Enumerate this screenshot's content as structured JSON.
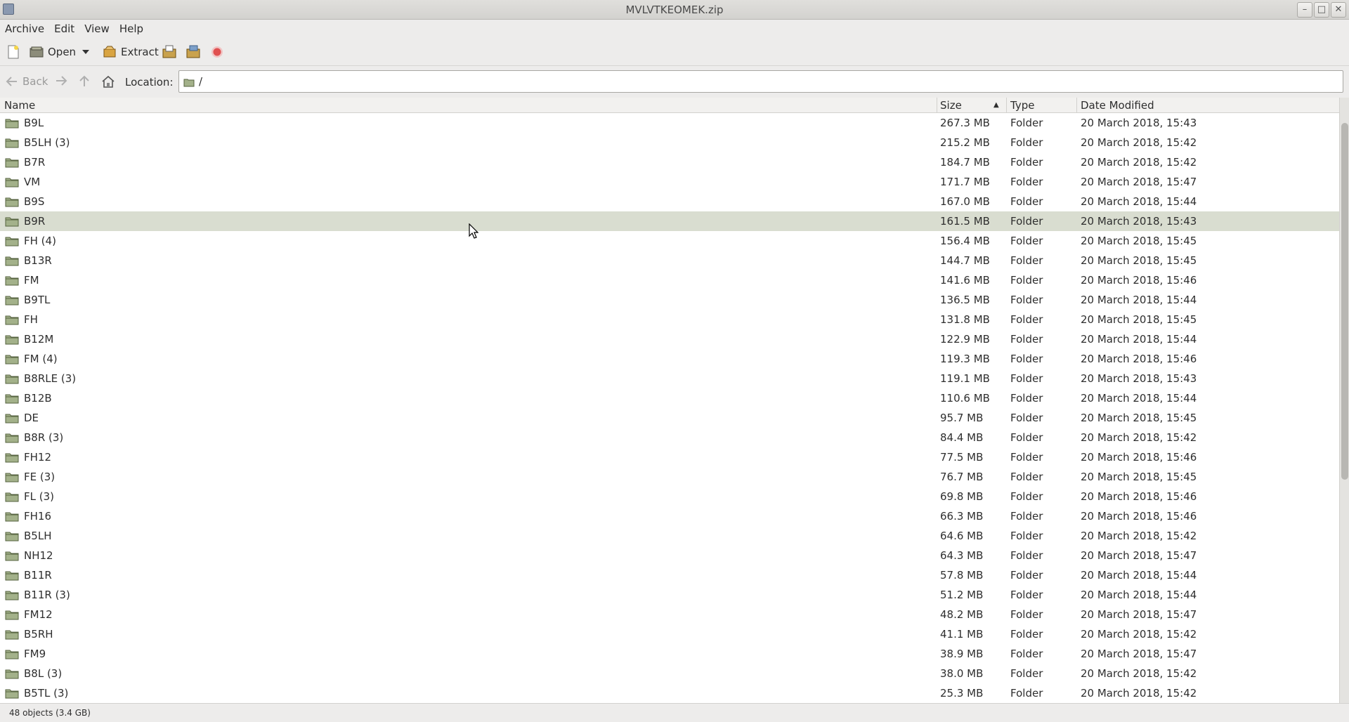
{
  "window": {
    "title": "MVLVTKEOMEK.zip",
    "min_glyph": "–",
    "max_glyph": "□",
    "close_glyph": "✕"
  },
  "menu": [
    "Archive",
    "Edit",
    "View",
    "Help"
  ],
  "toolbar": {
    "open_label": "Open",
    "extract_label": "Extract"
  },
  "location": {
    "back_label": "Back",
    "label": "Location:",
    "path": "/"
  },
  "columns": {
    "name": "Name",
    "size": "Size",
    "type": "Type",
    "date": "Date Modified",
    "sort_glyph": "▲"
  },
  "rows": [
    {
      "name": "B9L",
      "size": "267.3 MB",
      "type": "Folder",
      "date": "20 March 2018, 15:43"
    },
    {
      "name": "B5LH (3)",
      "size": "215.2 MB",
      "type": "Folder",
      "date": "20 March 2018, 15:42"
    },
    {
      "name": "B7R",
      "size": "184.7 MB",
      "type": "Folder",
      "date": "20 March 2018, 15:42"
    },
    {
      "name": "VM",
      "size": "171.7 MB",
      "type": "Folder",
      "date": "20 March 2018, 15:47"
    },
    {
      "name": "B9S",
      "size": "167.0 MB",
      "type": "Folder",
      "date": "20 March 2018, 15:44"
    },
    {
      "name": "B9R",
      "size": "161.5 MB",
      "type": "Folder",
      "date": "20 March 2018, 15:43",
      "selected": true
    },
    {
      "name": "FH (4)",
      "size": "156.4 MB",
      "type": "Folder",
      "date": "20 March 2018, 15:45"
    },
    {
      "name": "B13R",
      "size": "144.7 MB",
      "type": "Folder",
      "date": "20 March 2018, 15:45"
    },
    {
      "name": "FM",
      "size": "141.6 MB",
      "type": "Folder",
      "date": "20 March 2018, 15:46"
    },
    {
      "name": "B9TL",
      "size": "136.5 MB",
      "type": "Folder",
      "date": "20 March 2018, 15:44"
    },
    {
      "name": "FH",
      "size": "131.8 MB",
      "type": "Folder",
      "date": "20 March 2018, 15:45"
    },
    {
      "name": "B12M",
      "size": "122.9 MB",
      "type": "Folder",
      "date": "20 March 2018, 15:44"
    },
    {
      "name": "FM (4)",
      "size": "119.3 MB",
      "type": "Folder",
      "date": "20 March 2018, 15:46"
    },
    {
      "name": "B8RLE (3)",
      "size": "119.1 MB",
      "type": "Folder",
      "date": "20 March 2018, 15:43"
    },
    {
      "name": "B12B",
      "size": "110.6 MB",
      "type": "Folder",
      "date": "20 March 2018, 15:44"
    },
    {
      "name": "DE",
      "size": "95.7 MB",
      "type": "Folder",
      "date": "20 March 2018, 15:45"
    },
    {
      "name": "B8R (3)",
      "size": "84.4 MB",
      "type": "Folder",
      "date": "20 March 2018, 15:42"
    },
    {
      "name": "FH12",
      "size": "77.5 MB",
      "type": "Folder",
      "date": "20 March 2018, 15:46"
    },
    {
      "name": "FE (3)",
      "size": "76.7 MB",
      "type": "Folder",
      "date": "20 March 2018, 15:45"
    },
    {
      "name": "FL (3)",
      "size": "69.8 MB",
      "type": "Folder",
      "date": "20 March 2018, 15:46"
    },
    {
      "name": "FH16",
      "size": "66.3 MB",
      "type": "Folder",
      "date": "20 March 2018, 15:46"
    },
    {
      "name": "B5LH",
      "size": "64.6 MB",
      "type": "Folder",
      "date": "20 March 2018, 15:42"
    },
    {
      "name": "NH12",
      "size": "64.3 MB",
      "type": "Folder",
      "date": "20 March 2018, 15:47"
    },
    {
      "name": "B11R",
      "size": "57.8 MB",
      "type": "Folder",
      "date": "20 March 2018, 15:44"
    },
    {
      "name": "B11R (3)",
      "size": "51.2 MB",
      "type": "Folder",
      "date": "20 March 2018, 15:44"
    },
    {
      "name": "FM12",
      "size": "48.2 MB",
      "type": "Folder",
      "date": "20 March 2018, 15:47"
    },
    {
      "name": "B5RH",
      "size": "41.1 MB",
      "type": "Folder",
      "date": "20 March 2018, 15:42"
    },
    {
      "name": "FM9",
      "size": "38.9 MB",
      "type": "Folder",
      "date": "20 March 2018, 15:47"
    },
    {
      "name": "B8L (3)",
      "size": "38.0 MB",
      "type": "Folder",
      "date": "20 March 2018, 15:42"
    },
    {
      "name": "B5TL (3)",
      "size": "25.3 MB",
      "type": "Folder",
      "date": "20 March 2018, 15:42"
    }
  ],
  "status": {
    "text": "48 objects (3.4 GB)"
  }
}
